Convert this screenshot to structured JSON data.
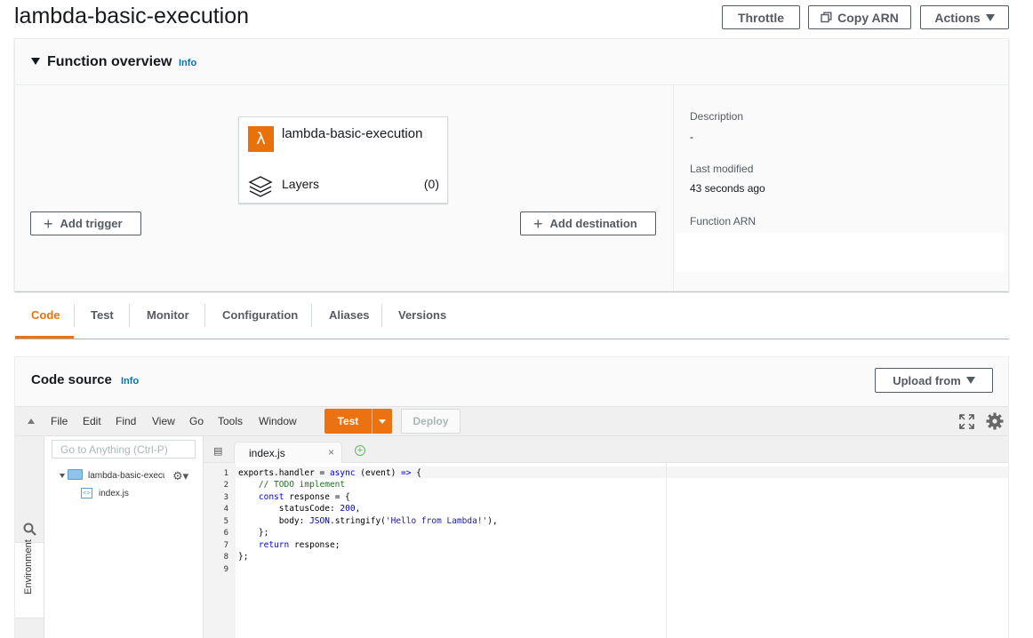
{
  "header": {
    "title": "lambda-basic-execution",
    "throttle_label": "Throttle",
    "copy_arn_label": "Copy ARN",
    "actions_label": "Actions"
  },
  "overview": {
    "title": "Function overview",
    "info_label": "Info",
    "function_name": "lambda-basic-execution",
    "layers_label": "Layers",
    "layers_count": "(0)",
    "add_trigger_label": "Add trigger",
    "add_destination_label": "Add destination",
    "description_label": "Description",
    "description_value": "-",
    "last_modified_label": "Last modified",
    "last_modified_value": "43 seconds ago",
    "function_arn_label": "Function ARN"
  },
  "tabs": [
    {
      "label": "Code",
      "active": true
    },
    {
      "label": "Test"
    },
    {
      "label": "Monitor"
    },
    {
      "label": "Configuration"
    },
    {
      "label": "Aliases"
    },
    {
      "label": "Versions"
    }
  ],
  "code_source": {
    "title": "Code source",
    "info_label": "Info",
    "upload_label": "Upload from"
  },
  "ide": {
    "menu": [
      "File",
      "Edit",
      "Find",
      "View",
      "Go",
      "Tools",
      "Window"
    ],
    "test_label": "Test",
    "deploy_label": "Deploy",
    "search_placeholder": "Go to Anything (Ctrl-P)",
    "environment_label": "Environment",
    "folder_name": "lambda-basic-execution",
    "file_name": "index.js",
    "open_tab": "index.js",
    "line_numbers": [
      "1",
      "2",
      "3",
      "4",
      "5",
      "6",
      "7",
      "8",
      "9"
    ]
  },
  "colors": {
    "accent": "#ec7211",
    "link": "#0073bb",
    "text": "#16191f"
  }
}
